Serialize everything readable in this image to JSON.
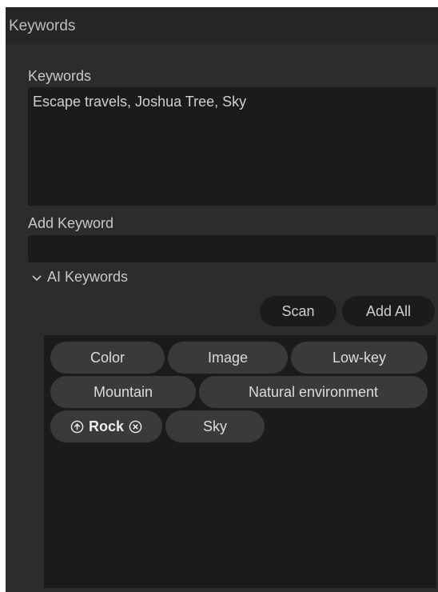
{
  "panel": {
    "title": "Keywords"
  },
  "keywords": {
    "label": "Keywords",
    "value": "Escape travels, Joshua Tree, Sky"
  },
  "add_keyword": {
    "label": "Add Keyword",
    "placeholder": ""
  },
  "ai_keywords": {
    "toggle_label": "AI Keywords",
    "expanded": true,
    "scan_label": "Scan",
    "add_all_label": "Add All",
    "chips": [
      {
        "label": "Color"
      },
      {
        "label": "Image"
      },
      {
        "label": "Low-key"
      },
      {
        "label": "Mountain"
      },
      {
        "label": "Natural environment"
      },
      {
        "label": "Rock",
        "selected": true,
        "icons": [
          "up-arrow-circle-icon",
          "remove-circle-icon"
        ]
      },
      {
        "label": "Sky"
      }
    ]
  },
  "colors": {
    "background": "#2c2c2c",
    "header": "#262626",
    "field": "#1b1b1b",
    "chip": "#3a3a3a",
    "text": "#c8c8c8"
  }
}
